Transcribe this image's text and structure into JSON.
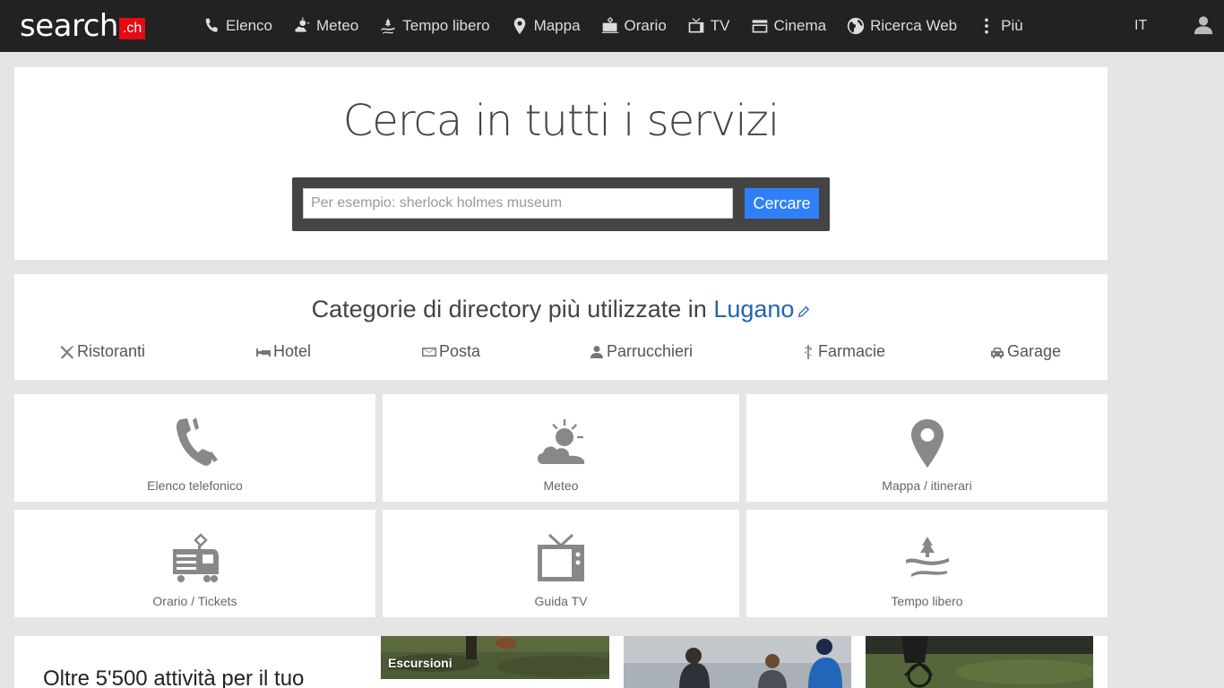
{
  "brand": {
    "word": "search",
    "tld": ".ch",
    "tld_color": "#e60a14"
  },
  "nav": {
    "items": [
      {
        "label": "Elenco",
        "icon": "phone-icon"
      },
      {
        "label": "Meteo",
        "icon": "weather-icon"
      },
      {
        "label": "Tempo libero",
        "icon": "leisure-icon"
      },
      {
        "label": "Mappa",
        "icon": "map-pin-icon"
      },
      {
        "label": "Orario",
        "icon": "train-icon"
      },
      {
        "label": "TV",
        "icon": "tv-icon"
      },
      {
        "label": "Cinema",
        "icon": "cinema-icon"
      },
      {
        "label": "Ricerca Web",
        "icon": "globe-icon"
      },
      {
        "label": "Più",
        "icon": "more-vertical-icon"
      }
    ],
    "language": "IT",
    "user_icon": "user-icon"
  },
  "search": {
    "title": "Cerca in tutti i servizi",
    "placeholder": "Per esempio: sherlock holmes museum",
    "value": "",
    "button": "Cercare",
    "button_color": "#2f80f8"
  },
  "categories": {
    "title_prefix": "Categorie di directory più utilizzate in",
    "location": "Lugano",
    "items": [
      {
        "label": "Ristoranti",
        "icon": "cutlery-icon"
      },
      {
        "label": "Hotel",
        "icon": "bed-icon"
      },
      {
        "label": "Posta",
        "icon": "envelope-icon"
      },
      {
        "label": "Parrucchieri",
        "icon": "person-icon"
      },
      {
        "label": "Farmacie",
        "icon": "caduceus-icon"
      },
      {
        "label": "Garage",
        "icon": "car-icon"
      }
    ]
  },
  "services": [
    {
      "label": "Elenco telefonico",
      "icon": "phone-icon"
    },
    {
      "label": "Meteo",
      "icon": "weather-icon"
    },
    {
      "label": "Mappa / itinerari",
      "icon": "map-pin-icon"
    },
    {
      "label": "Orario / Tickets",
      "icon": "train-icon"
    },
    {
      "label": "Guida TV",
      "icon": "tv-icon"
    },
    {
      "label": "Tempo libero",
      "icon": "leisure-icon"
    }
  ],
  "promo": {
    "headline": "Oltre 5'500 attività per il tuo",
    "cards": [
      {
        "label": "Escursioni"
      },
      {
        "label": ""
      },
      {
        "label": ""
      }
    ]
  }
}
